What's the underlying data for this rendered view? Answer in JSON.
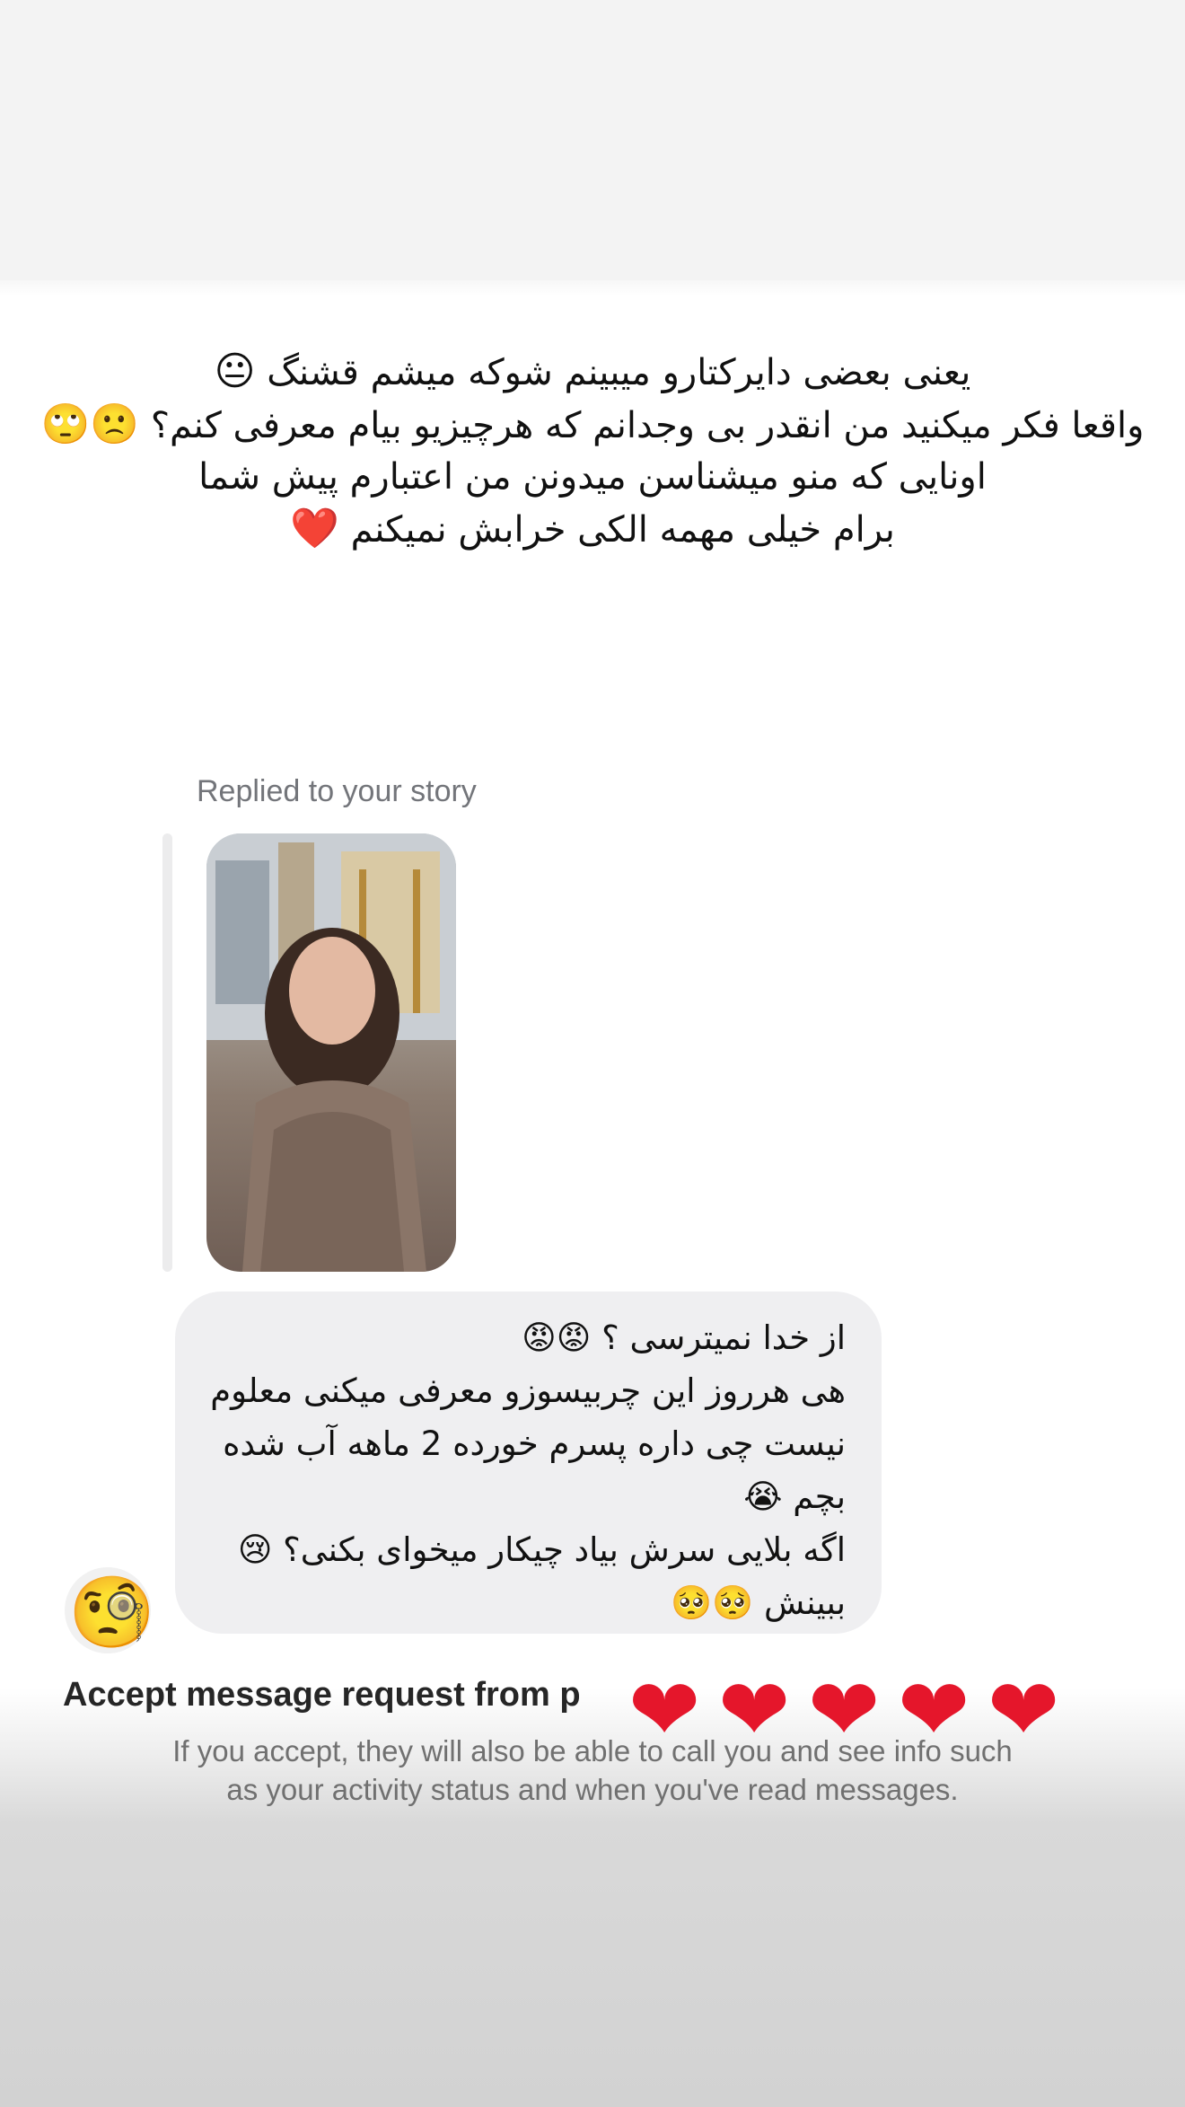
{
  "caption": {
    "lines": [
      "یعنی بعضی دایرکتارو میبینم شوکه میشم قشنگ",
      "واقعا فکر میکنید من انقدر بی وجدانم که هرچیزیو بیام معرفی کنم؟",
      "اونایی که منو میشناسن میدونن من اعتبارم پیش شما",
      "برام خیلی مهمه الکی خرابش نمیکنم"
    ],
    "emojis": {
      "line1": "😐",
      "line2": "🙁🙄",
      "line4": "❤️"
    }
  },
  "dm": {
    "replied_label": "Replied to your story",
    "bubble_lines": [
      "از خدا نمیترسی ؟",
      "هی هرروز این چربیسوزو معرفی میکنی معلوم",
      "نیست چی داره پسرم خورده 2 ماهه آب شده",
      "بچم",
      "اگه بلایی سرش بیاد چیکار میخوای بکنی؟",
      "ببینش"
    ],
    "bubble_emojis": {
      "line1": "😡😡",
      "line4": "😭",
      "line5": "😢",
      "line6": "🥺🥺"
    },
    "avatar_icon": "monocle-face-emoji"
  },
  "request": {
    "title": "Accept message request from p",
    "body_line1": "If you accept, they will also be able to call you and see info such",
    "body_line2": "as your activity status and when you've read messages."
  },
  "stickers": {
    "hearts": [
      "❤",
      "❤",
      "❤",
      "❤",
      "❤"
    ],
    "heart_color": "#e5162b"
  }
}
